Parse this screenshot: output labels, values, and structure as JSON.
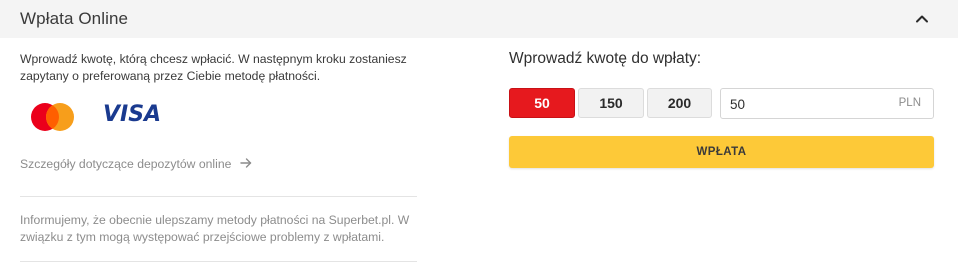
{
  "header": {
    "title": "Wpłata Online",
    "collapse_icon": "chevron-up-icon"
  },
  "left": {
    "intro": "Wprowadź kwotę, którą chcesz wpłacić. W następnym kroku zostaniesz zapytany o preferowaną przez Ciebie metodę płatności.",
    "payment_logos": [
      {
        "name": "Mastercard",
        "icon": "mastercard-logo",
        "colors": [
          "#eb001b",
          "#f79e1b"
        ]
      },
      {
        "name": "VISA",
        "icon": "visa-logo",
        "color": "#1a3a8f"
      }
    ],
    "details_link": "Szczegóły dotyczące depozytów online",
    "details_arrow_icon": "arrow-right-icon",
    "notice": "Informujemy, że obecnie ulepszamy metody płatności na Superbet.pl. W związku z tym mogą występować przejściowe problemy z wpłatami."
  },
  "right": {
    "amount_label": "Wprowadź kwotę do wpłaty:",
    "quick_amounts": [
      {
        "label": "50",
        "selected": true
      },
      {
        "label": "150",
        "selected": false
      },
      {
        "label": "200",
        "selected": false
      }
    ],
    "amount_value": "50",
    "currency": "PLN",
    "submit_label": "WPŁATA"
  },
  "colors": {
    "accent_red": "#e6191e",
    "submit_yellow": "#fdc938",
    "header_bg": "#f4f4f4"
  }
}
